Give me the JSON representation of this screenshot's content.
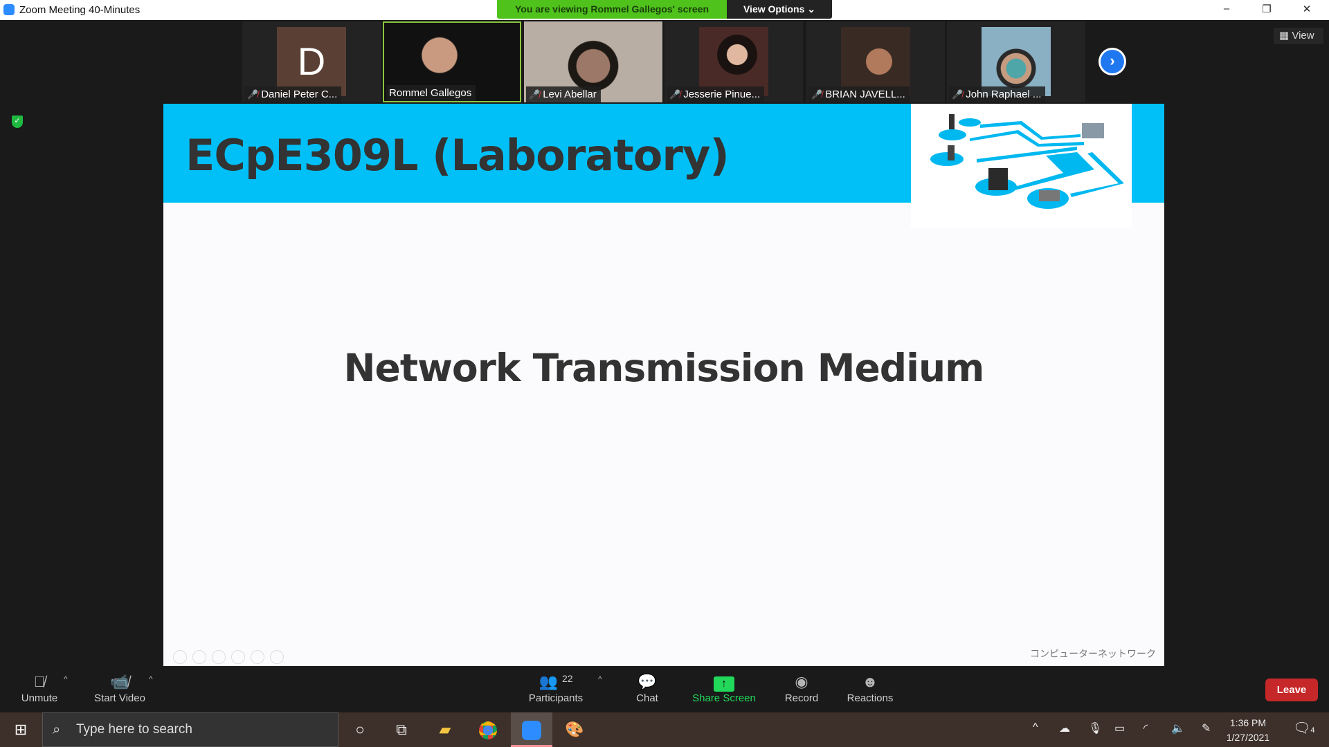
{
  "window": {
    "title": "Zoom Meeting 40-Minutes",
    "minimize": "–",
    "restore": "❐",
    "close": "✕"
  },
  "banner": {
    "text": "You are viewing Rommel Gallegos' screen",
    "view_options": "View Options ⌄",
    "color": "#4fc21c"
  },
  "gallery": {
    "participants": [
      {
        "name": "Daniel Peter C...",
        "muted": true,
        "initial": "D"
      },
      {
        "name": "Rommel Gallegos",
        "muted": false,
        "active_speaker": true
      },
      {
        "name": "Levi Abellar",
        "muted": true
      },
      {
        "name": "Jesserie Pinue...",
        "muted": true
      },
      {
        "name": "BRIAN JAVELL...",
        "muted": true
      },
      {
        "name": "John Raphael ...",
        "muted": true
      }
    ],
    "next_icon": "›",
    "view_label": "View"
  },
  "slide": {
    "title": "ECpE309L (Laboratory)",
    "subtitle": "Network Transmission Medium",
    "footer": "コンピューターネットワーク",
    "accent": "#00c0f7"
  },
  "toolbar": {
    "unmute": "Unmute",
    "start_video": "Start Video",
    "participants": "Participants",
    "participant_count": "22",
    "chat": "Chat",
    "share_screen": "Share Screen",
    "record": "Record",
    "reactions": "Reactions",
    "leave": "Leave",
    "caret": "^"
  },
  "taskbar": {
    "search_placeholder": "Type here to search",
    "time": "1:36 PM",
    "date": "1/27/2021",
    "notifications": "4"
  }
}
